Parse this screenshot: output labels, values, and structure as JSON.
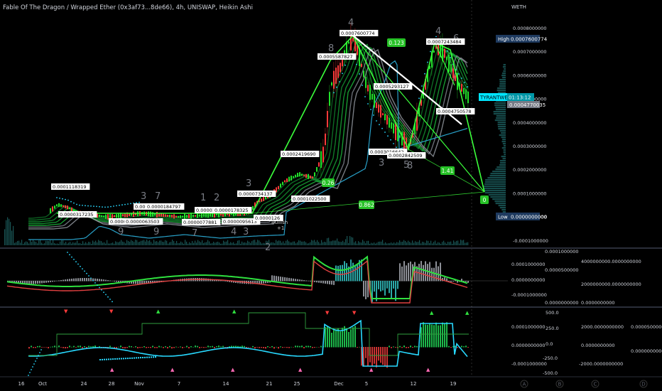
{
  "header": {
    "title": "Fable Of The Dragon / Wrapped Ether (0x3af73...8de66), 4h, UNISWAP, Heikin Ashi",
    "currency": "WETH"
  },
  "price_axis": {
    "ticks": [
      "0.0008000000",
      "0.0007000000",
      "0.0006000000",
      "0.0005000000",
      "0.0004000000",
      "0.0003000000",
      "0.0002000000",
      "0.0001000000",
      "0.0000000000",
      "-0.0001000000"
    ],
    "high_label": "High",
    "high_value": "0.0007600774",
    "low_label": "Low",
    "low_value": "0.0000000000",
    "symbol_tag": "TYRANTWETH",
    "countdown": "01:13:12",
    "last_price": "0.0004770035"
  },
  "pattern": {
    "ratios": [
      "0.123",
      "1.41",
      "0.862",
      "0.26",
      "0"
    ],
    "wave_numbers": [
      "8",
      "4",
      "4",
      "6",
      "3",
      "5",
      "8",
      "3",
      "7",
      "1",
      "2",
      "9",
      "3",
      "4",
      "7",
      "3",
      "9",
      "2"
    ],
    "point_labels": [
      "0.0001118319",
      "0.0000317235",
      "0.0000",
      "0.0000184797",
      "0.0000081",
      "0.0000063503",
      "0.0000077881",
      "0.0000163",
      "0.0000178325",
      "0.0000095613",
      "0.0000734137",
      "0.0000126",
      "0.0002419690",
      "0.0001022500",
      "0.0007600774",
      "0.0005587827",
      "0.0005293127",
      "0.0003016642",
      "0.0002842509",
      "0.0007243484",
      "0.0004750578"
    ],
    "annotation": "Bullish",
    "annotation_sub": "+1"
  },
  "panel2_axis": {
    "left_ticks": [
      "0.0001000000",
      "0.0000000000",
      "-0.0001000000"
    ],
    "top_value": "0.0001000000",
    "mid_value": "0.0000500000",
    "low_value": "0.0000000000",
    "right_ticks": [
      "4000000000.0000000000",
      "2000000000.0000000000",
      "0.0000000000"
    ]
  },
  "panel3_axis": {
    "left_ticks": [
      "0.0001000000",
      "0.0000000000",
      "-0.0001000000"
    ],
    "osc_ticks": [
      "500.0",
      "250.0",
      "0.0",
      "-250.0",
      "-500.0"
    ],
    "right_ticks": [
      "2000.0000000000",
      "0.0000000000",
      "-2000.0000000000"
    ],
    "far_ticks": [
      "0.0000500000",
      "0.0000000000"
    ]
  },
  "time_axis": {
    "labels": [
      "16",
      "Oct",
      "24",
      "28",
      "Nov",
      "7",
      "14",
      "21",
      "25",
      "Dec",
      "5",
      "12",
      "19"
    ],
    "buttons": [
      "A",
      "B",
      "C",
      "D"
    ]
  },
  "colors": {
    "bg": "#000000",
    "up": "#22e02a",
    "down": "#ff3b3b",
    "pattern": "#3bff3b",
    "trend": "#ffffff",
    "cyan": "#28d9ff",
    "badge": "#27c227"
  }
}
